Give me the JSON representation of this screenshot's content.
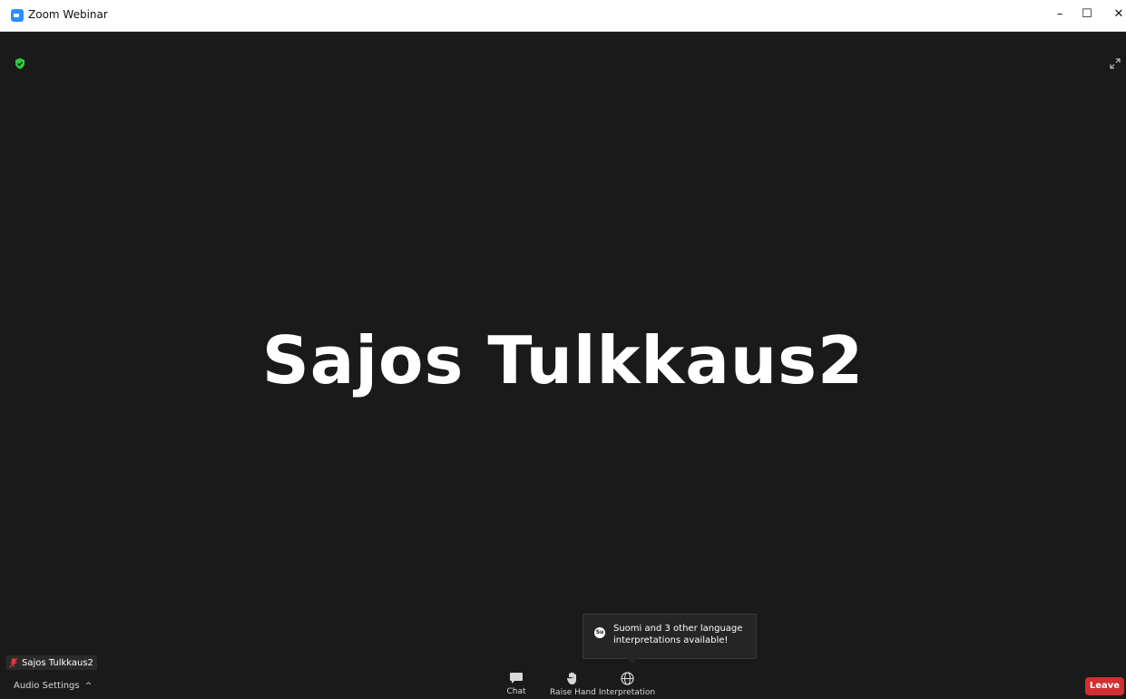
{
  "window": {
    "title": "Zoom Webinar",
    "minimize_glyph": "–",
    "maximize_glyph": "☐",
    "close_glyph": "✕"
  },
  "stage": {
    "speaker_name": "Sajos Tulkkaus2",
    "security_icon": "shield-check-icon",
    "fullscreen_icon": "expand-icon"
  },
  "tooltip": {
    "icon_text": "Su",
    "message": "Suomi and 3 other language interpretations available!"
  },
  "nametag": {
    "label": "Sajos Tulkkaus2",
    "icon": "mic-muted-icon"
  },
  "bottombar": {
    "audio_settings_label": "Audio Settings",
    "audio_caret": "^",
    "chat_label": "Chat",
    "raise_hand_label": "Raise Hand",
    "interpretation_label": "Interpretation",
    "leave_label": "Leave"
  },
  "colors": {
    "stage_background": "#1a1a1a",
    "leave_red": "#d0302f",
    "security_green": "#2ecc40",
    "zoom_blue": "#2d8cff"
  }
}
